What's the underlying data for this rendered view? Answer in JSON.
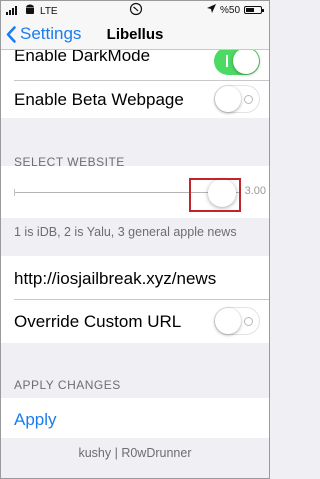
{
  "status_bar": {
    "carrier": "LTE",
    "battery_text": "%50",
    "battery_level": 0.5
  },
  "nav": {
    "back_label": "Settings",
    "title": "Libellus"
  },
  "cells": {
    "dark_mode": {
      "label": "Enable DarkMode",
      "on": true
    },
    "beta_webpage": {
      "label": "Enable Beta Webpage",
      "on": false
    }
  },
  "select_website": {
    "header": "SELECT WEBSITE",
    "slider_value_text": "3.00",
    "slider_fraction": 0.96,
    "footer": "1 is iDB, 2 is Yalu, 3 general apple news"
  },
  "custom_url": {
    "url": "http://iosjailbreak.xyz/news",
    "override_label": "Override Custom URL",
    "override_on": false
  },
  "apply": {
    "header": "APPLY CHANGES",
    "button_label": "Apply",
    "credits": "kushy | R0wDrunner"
  },
  "colors": {
    "accent": "#1a7cf0",
    "toggle_on": "#4cd964",
    "highlight": "#c0252b",
    "background": "#efeff4"
  }
}
